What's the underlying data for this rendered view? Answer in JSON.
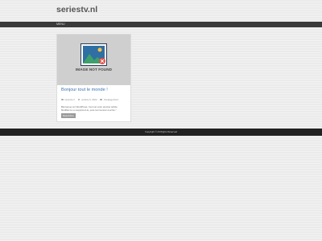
{
  "site": {
    "title": "seriestv.nl"
  },
  "nav": {
    "items": [
      {
        "label": "MENU"
      }
    ]
  },
  "post": {
    "thumbnail_text": "IMAGE NOT FOUND",
    "title": "Bonjour tout le monde !",
    "meta": {
      "author": "seriestv.nl",
      "date": "octobre 6, 2022",
      "category": "Uncategorized"
    },
    "excerpt": "Bienvenue sur WordPress. Ceci est votre premier article. Modifiez-le ou supprimez-le, puis commencez à écrire !",
    "read_more_label": "Read More"
  },
  "footer": {
    "copyright": "Copyright © All Rights Reserved"
  },
  "colors": {
    "accent": "#3b74b5",
    "nav_bg": "#3a3a3a",
    "footer_bg": "#222222",
    "button_bg": "#9a9a9a"
  },
  "icons": [
    "image-not-found-icon",
    "author-icon",
    "calendar-icon",
    "folder-icon"
  ]
}
